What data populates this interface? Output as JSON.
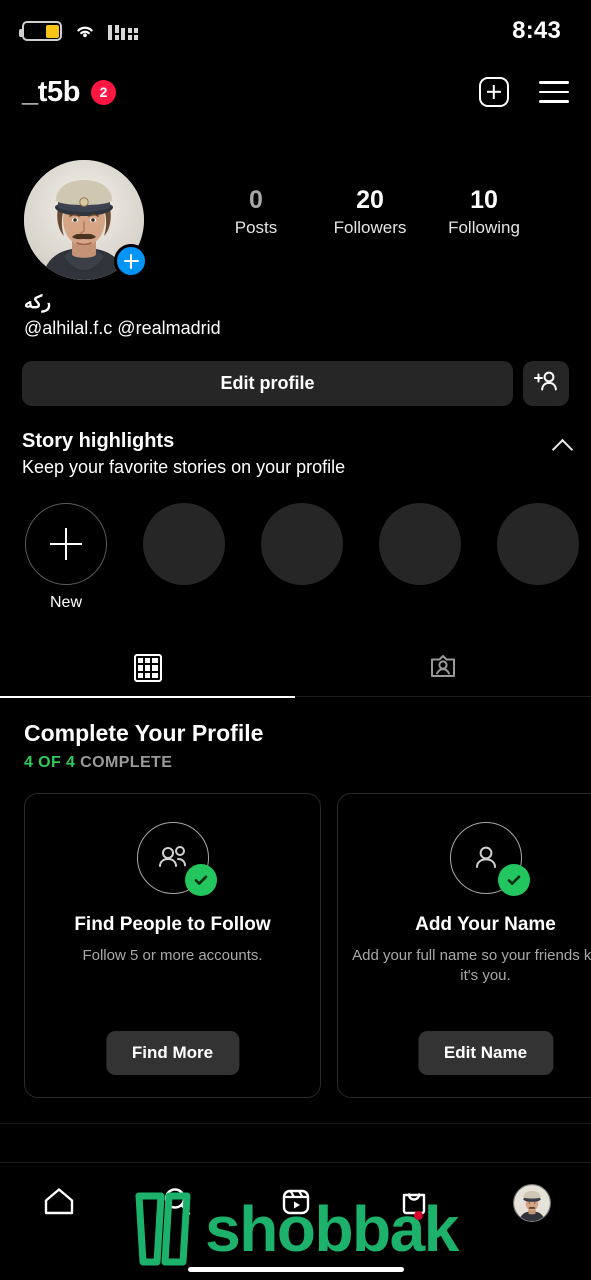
{
  "status_bar": {
    "time": "8:43",
    "battery_icon": "battery-low-power-icon",
    "wifi_icon": "wifi-icon",
    "signal_icon": "cellular-signal-icon"
  },
  "header": {
    "username": "_t5b",
    "badge_count": "2",
    "new_post_icon": "plus-square-icon",
    "menu_icon": "hamburger-menu-icon"
  },
  "profile": {
    "avatar_icon": "profile-avatar",
    "avatar_add_story_icon": "plus-circle-icon",
    "stats": [
      {
        "num": "0",
        "label": "Posts"
      },
      {
        "num": "20",
        "label": "Followers"
      },
      {
        "num": "10",
        "label": "Following"
      }
    ],
    "display_name": "ركه",
    "bio": "@alhilal.f.c @realmadrid"
  },
  "actions": {
    "edit_profile_label": "Edit profile",
    "add_user_icon": "add-person-icon"
  },
  "story_highlights": {
    "title": "Story highlights",
    "subtitle": "Keep your favorite stories on your profile",
    "collapse_icon": "chevron-up-icon",
    "new_label": "New",
    "new_icon": "plus-icon",
    "placeholders": 4
  },
  "tabs": {
    "grid_icon": "grid-icon",
    "tagged_icon": "tagged-person-card-icon",
    "active": "grid"
  },
  "complete_profile": {
    "title": "Complete Your Profile",
    "progress_count": "4 OF 4",
    "progress_word": "COMPLETE",
    "progress_color": "#2ECC59",
    "cards": [
      {
        "icon": "two-people-icon",
        "check_icon": "check-circle-icon",
        "title": "Find People to Follow",
        "desc": "Follow 5 or more accounts.",
        "button": "Find More"
      },
      {
        "icon": "person-icon",
        "check_icon": "check-circle-icon",
        "title": "Add Your Name",
        "desc": "Add your full name so your friends know it's you.",
        "button": "Edit Name"
      }
    ]
  },
  "bottom_nav": {
    "items": [
      {
        "icon": "home-icon"
      },
      {
        "icon": "search-icon"
      },
      {
        "icon": "reels-icon"
      },
      {
        "icon": "shop-bag-icon"
      },
      {
        "icon": "profile-avatar-icon"
      }
    ]
  },
  "watermark": {
    "text": "shobbak",
    "color": "#1DB26B",
    "logo_icon": "shobbak-logo-icon"
  }
}
